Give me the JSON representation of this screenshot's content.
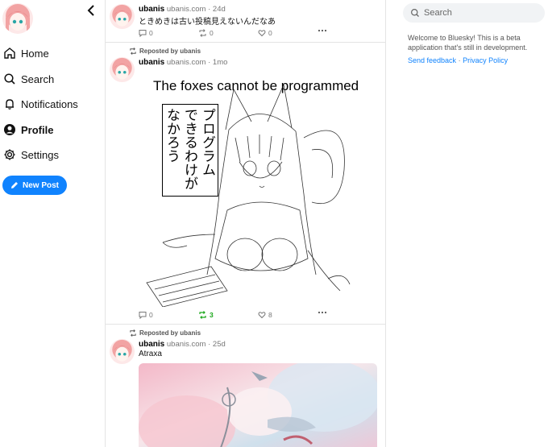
{
  "colors": {
    "accent": "#1083fe",
    "repost_green": "#19a619",
    "muted": "#777777",
    "divider": "#e4e4e4"
  },
  "sidebar": {
    "items": [
      {
        "icon": "home-icon",
        "label": "Home"
      },
      {
        "icon": "search-icon",
        "label": "Search"
      },
      {
        "icon": "bell-icon",
        "label": "Notifications"
      },
      {
        "icon": "user-circle-icon",
        "label": "Profile"
      },
      {
        "icon": "gear-icon",
        "label": "Settings"
      }
    ],
    "new_post": "New Post"
  },
  "feed": {
    "posts": [
      {
        "author": "ubanis",
        "handle": "ubanis.com",
        "time": "· 24d",
        "text": "ときめきは古い投稿見えないんだなあ",
        "replies": "0",
        "reposts": "0",
        "likes": "0"
      },
      {
        "reposted_by": "Reposted by ubanis",
        "author": "ubanis",
        "handle": "ubanis.com",
        "time": "· 1mo",
        "image_title": "The foxes cannot be programmed",
        "image_vertical_text": [
          "プログラム",
          "できるわけが",
          "なかろう"
        ],
        "replies": "0",
        "reposts": "3",
        "likes": "8"
      },
      {
        "reposted_by": "Reposted by ubanis",
        "author": "ubanis",
        "handle": "ubanis.com",
        "time": "· 25d",
        "text": "Atraxa"
      }
    ]
  },
  "right": {
    "search_placeholder": "Search",
    "welcome": "Welcome to Bluesky! This is a beta application that's still in development.",
    "send_feedback": "Send feedback",
    "separator": "·",
    "privacy_policy": "Privacy Policy"
  }
}
